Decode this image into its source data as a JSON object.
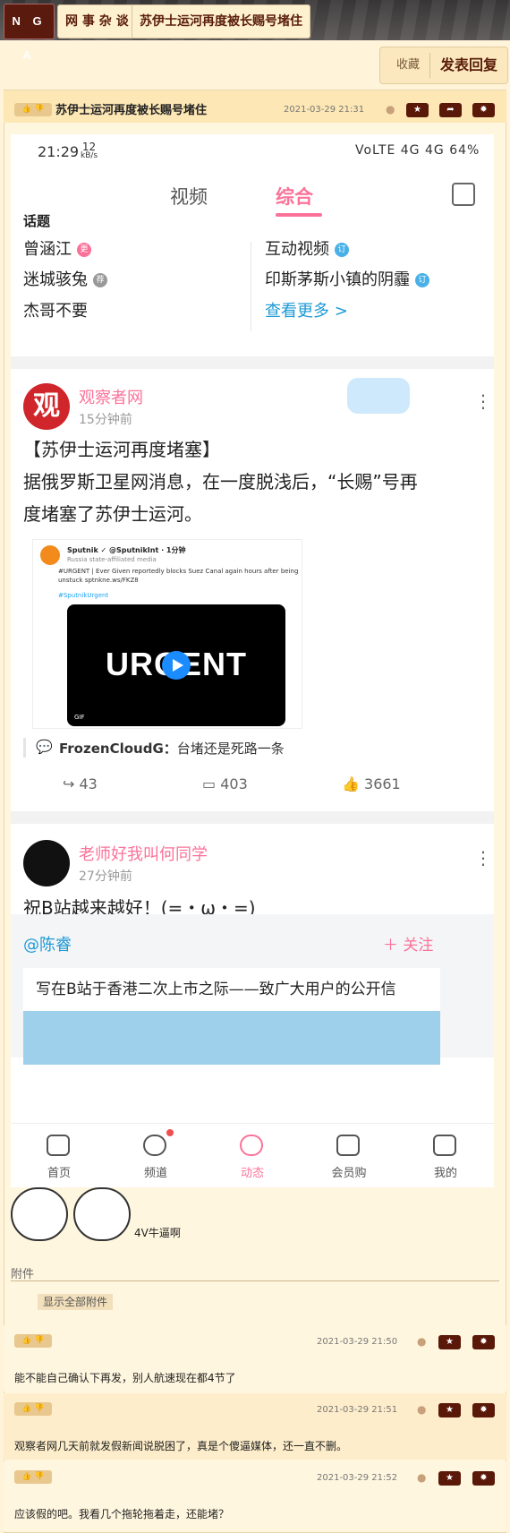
{
  "nav": {
    "logo": "N G A",
    "crumbs": [
      "网 事 杂 谈",
      "苏伊士运河再度被长赐号堵住"
    ],
    "fav": "收藏",
    "reply": "发表回复"
  },
  "post": {
    "likes": "👍 👎",
    "title": "苏伊士运河再度被长赐号堵住",
    "time": "2021-03-29 21:31",
    "phone": {
      "time": "21:29",
      "speed_top": "12",
      "speed_unit": "kB/s",
      "status_right": "VoLTE 4G 4G 64%",
      "tabs": [
        "视频",
        "综合"
      ],
      "topics_header": "话题",
      "topics_left": [
        "曾涵江",
        "迷城骇兔",
        "杰哥不要"
      ],
      "topics_left_badges": [
        "更",
        "荐",
        ""
      ],
      "topics_right": [
        "互动视频",
        "印斯茅斯小镇的阴霾",
        "查看更多 >"
      ],
      "topics_right_badges": [
        "订",
        "订",
        ""
      ],
      "card1": {
        "avatar_text": "观",
        "user": "观察者网",
        "time": "15分钟前",
        "text_line1": "【苏伊士运河再度堵塞】",
        "text_line2": "据俄罗斯卫星网消息，在一度脱浅后，“长赐”号再",
        "text_line3": "度堵塞了苏伊士运河。",
        "tweet_name": "Sputnik ✓ @SputnikInt · 1分钟",
        "tweet_tag": "Russia state-affiliated media",
        "tweet_text": "#URGENT | Ever Given reportedly blocks Suez Canal again hours after being unstuck sptnkne.ws/FKZ8",
        "tweet_link": "#SputnikUrgent",
        "video_text": "URGENT",
        "gif": "GIF",
        "comment_user": "FrozenCloudG：",
        "comment_text": "台堵还是死路一条",
        "shares": "43",
        "comments": "403",
        "likes": "3661"
      },
      "card2": {
        "user": "老师好我叫何同学",
        "time": "27分钟前",
        "text": "祝B站越来越好！(=・ω・=)",
        "at": "@陈睿",
        "follow": "＋ 关注",
        "letter": "写在B站于香港二次上市之际——致广大用户的公开信"
      },
      "navbar": [
        "首页",
        "频道",
        "动态",
        "会员购",
        "我的"
      ]
    },
    "sticker_caption": "4V牛逼啊",
    "attach_header": "附件",
    "show_all": "显示全部附件"
  },
  "replies": [
    {
      "time": "2021-03-29 21:50",
      "text": "能不能自己确认下再发，别人航速现在都4节了"
    },
    {
      "time": "2021-03-29 21:51",
      "text": "观察者网几天前就发假新闻说脱困了，真是个傻逼媒体，还一直不删。"
    },
    {
      "time": "2021-03-29 21:52",
      "text": "应该假的吧。我看几个拖轮拖着走，还能堵？"
    }
  ],
  "colors": {
    "accent": "#fb7299",
    "brand": "#5a1808",
    "link": "#1e9ad6"
  }
}
